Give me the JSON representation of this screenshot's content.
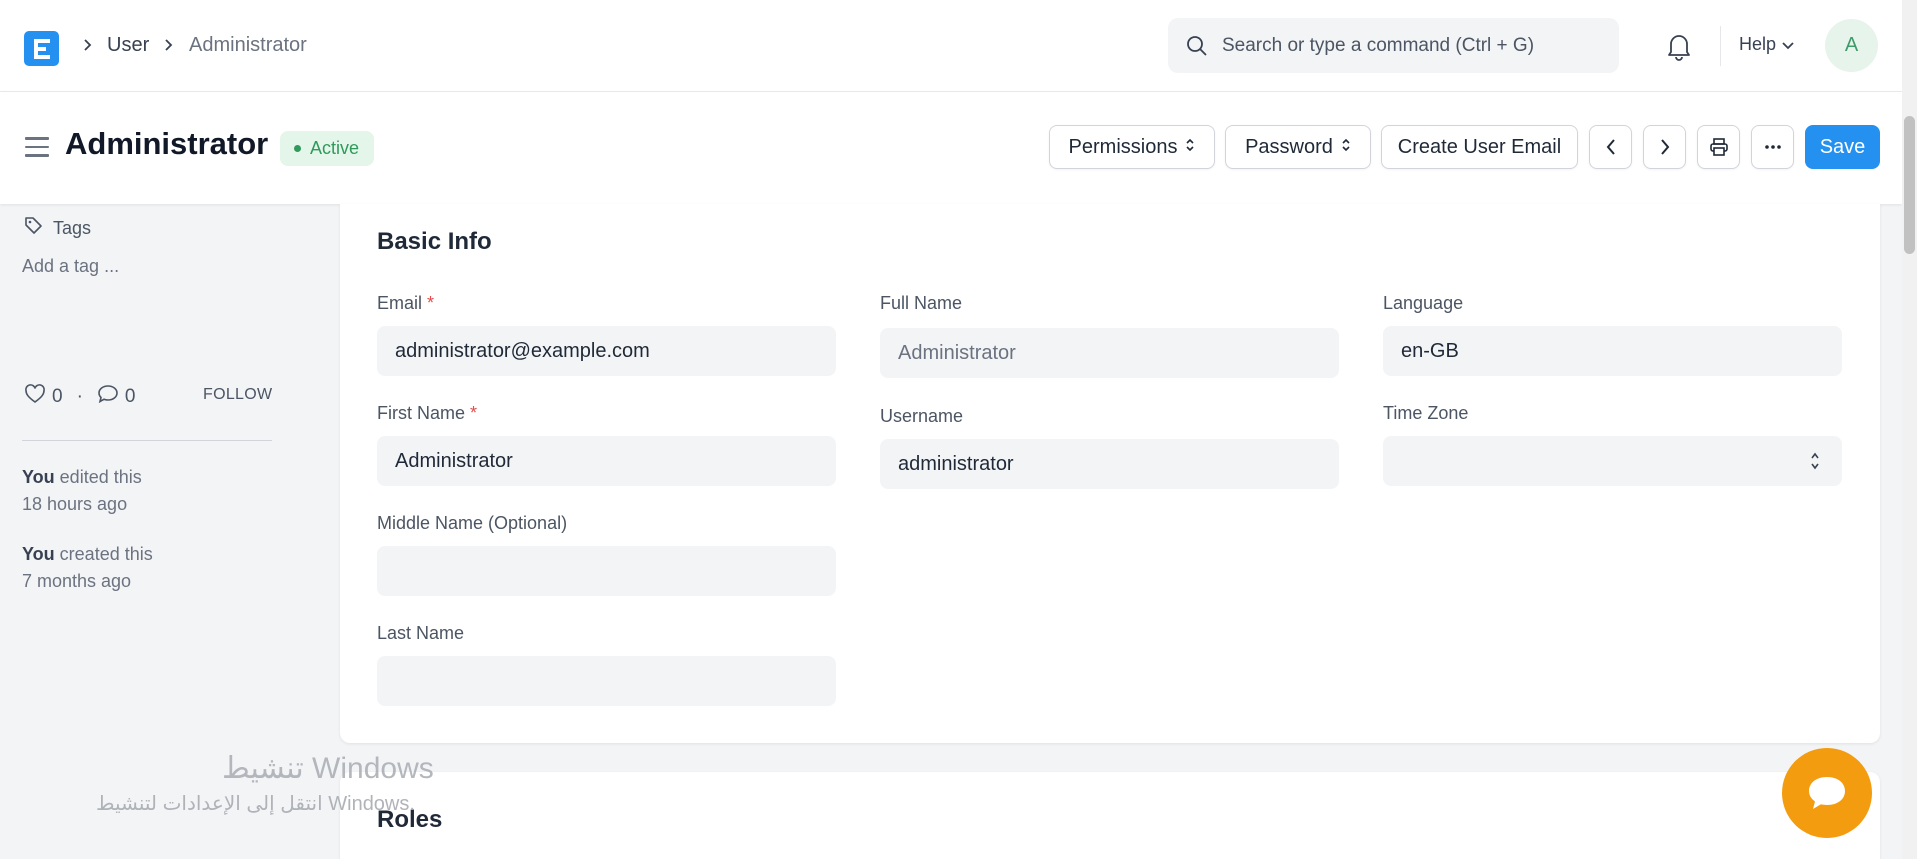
{
  "navbar": {
    "breadcrumbs": [
      "User",
      "Administrator"
    ],
    "search_placeholder": "Search or type a command (Ctrl + G)",
    "help_label": "Help",
    "avatar_initial": "A"
  },
  "header": {
    "title": "Administrator",
    "status": "Active",
    "buttons": {
      "permissions": "Permissions",
      "password": "Password",
      "create_user_email": "Create User Email",
      "save": "Save"
    }
  },
  "sidebar": {
    "tags_label": "Tags",
    "add_tag": "Add a tag ...",
    "likes": "0",
    "comments": "0",
    "follow": "FOLLOW",
    "activity": [
      {
        "actor": "You",
        "action": " edited this",
        "time": "18 hours ago"
      },
      {
        "actor": "You",
        "action": " created this",
        "time": "7 months ago"
      }
    ]
  },
  "basic_info": {
    "title": "Basic Info",
    "email_label": "Email",
    "email_value": "administrator@example.com",
    "first_name_label": "First Name",
    "first_name_value": "Administrator",
    "middle_name_label": "Middle Name (Optional)",
    "middle_name_value": "",
    "last_name_label": "Last Name",
    "last_name_value": "",
    "full_name_label": "Full Name",
    "full_name_value": "Administrator",
    "username_label": "Username",
    "username_value": "administrator",
    "language_label": "Language",
    "language_value": "en-GB",
    "time_zone_label": "Time Zone",
    "time_zone_value": ""
  },
  "roles": {
    "title": "Roles"
  },
  "watermark": {
    "line1": "تنشيط Windows",
    "line2": "انتقل إلى الإعدادات لتنشيط Windows."
  },
  "colors": {
    "primary": "#2490ef",
    "status_active": "#2f9a5b",
    "chat": "#f39c0f",
    "required": "#e24c4c"
  }
}
